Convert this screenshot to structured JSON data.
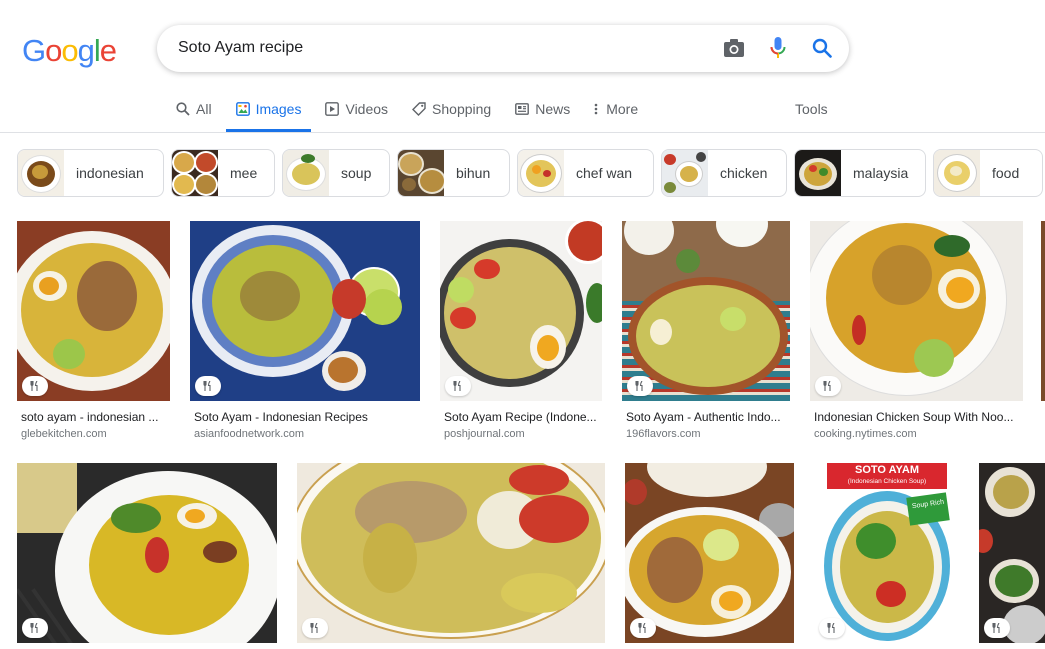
{
  "logo": {
    "letters": [
      "G",
      "o",
      "o",
      "g",
      "l",
      "e"
    ],
    "colors": [
      "#4285f4",
      "#ea4335",
      "#fbbc05",
      "#4285f4",
      "#34a853",
      "#ea4335"
    ]
  },
  "search": {
    "query": "Soto Ayam recipe"
  },
  "icons": {
    "camera": "camera-icon",
    "mic": "mic-icon",
    "search": "search-icon",
    "utensils": "utensils-icon"
  },
  "tabs": [
    {
      "label": "All",
      "icon": "search-icon"
    },
    {
      "label": "Images",
      "icon": "image-icon",
      "active": true
    },
    {
      "label": "Videos",
      "icon": "play-icon"
    },
    {
      "label": "Shopping",
      "icon": "tag-icon"
    },
    {
      "label": "News",
      "icon": "news-icon"
    },
    {
      "label": "More",
      "icon": "kebab-icon"
    }
  ],
  "tools_label": "Tools",
  "chips": [
    {
      "label": "indonesian"
    },
    {
      "label": "mee"
    },
    {
      "label": "soup"
    },
    {
      "label": "bihun"
    },
    {
      "label": "chef wan"
    },
    {
      "label": "chicken"
    },
    {
      "label": "malaysia"
    },
    {
      "label": "food"
    }
  ],
  "row1": [
    {
      "title": "soto ayam - indonesian ...",
      "source": "glebekitchen.com"
    },
    {
      "title": "Soto Ayam - Indonesian Recipes",
      "source": "asianfoodnetwork.com"
    },
    {
      "title": "Soto Ayam Recipe (Indone...",
      "source": "poshjournal.com"
    },
    {
      "title": "Soto Ayam - Authentic Indo...",
      "source": "196flavors.com"
    },
    {
      "title": "Indonesian Chicken Soup With Noo...",
      "source": "cooking.nytimes.com"
    }
  ],
  "poster": {
    "title": "SOTO AYAM",
    "subtitle": "(Indonesian Chicken Soup)",
    "sticker": "Soup Rich"
  },
  "colors": {
    "accent": "#1a73e8",
    "broth": "#d9b22e",
    "lime": "#a8cf45",
    "egg": "#f3a712",
    "tomato": "#d9332a"
  }
}
